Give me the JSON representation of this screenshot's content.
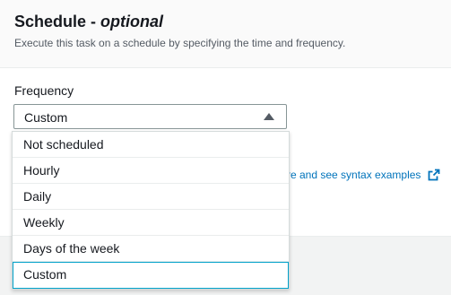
{
  "section": {
    "title_main": "Schedule - ",
    "title_optional": "optional",
    "description": "Execute this task on a schedule by specifying the time and frequency."
  },
  "frequency": {
    "label": "Frequency",
    "selected_value": "Custom",
    "options": [
      "Not scheduled",
      "Hourly",
      "Daily",
      "Weekly",
      "Days of the week",
      "Custom"
    ]
  },
  "syntax_link": {
    "text": "re and see syntax examples",
    "icon": "external-link-icon"
  },
  "colors": {
    "link": "#0073bb",
    "selected_border": "#00a1c9",
    "header_bg": "#fafafa"
  }
}
